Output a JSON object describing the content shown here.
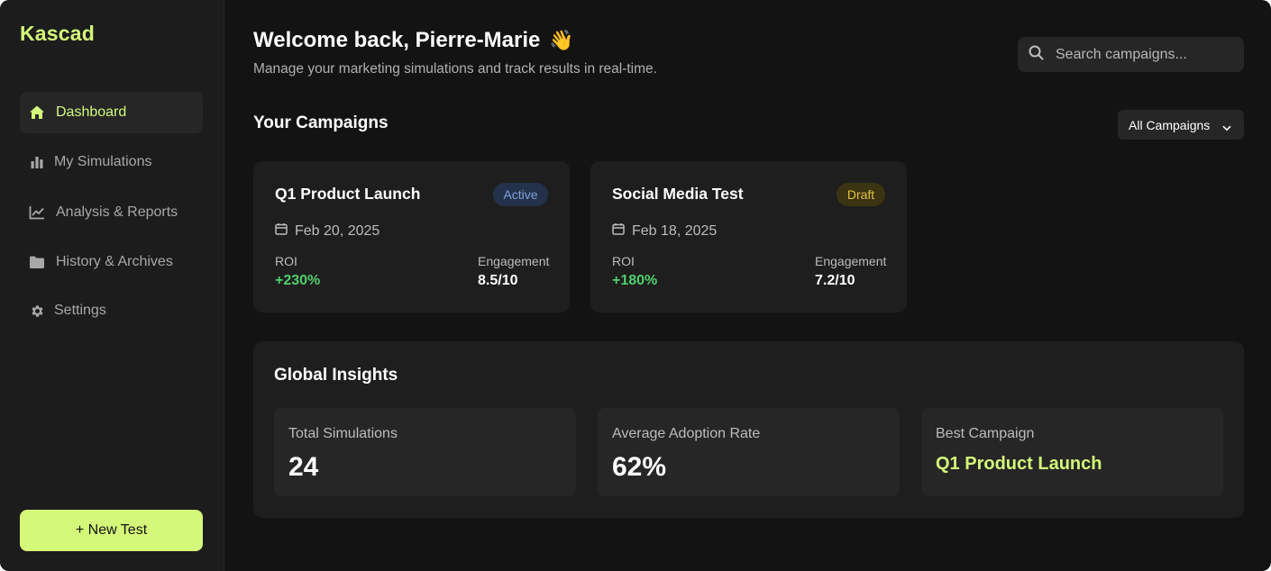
{
  "app": {
    "name": "Kascad",
    "accent_color": "#d4f87a"
  },
  "sidebar": {
    "items": [
      {
        "label": "Dashboard",
        "icon": "home-icon",
        "active": true
      },
      {
        "label": "My Simulations",
        "icon": "bar-chart-icon",
        "active": false
      },
      {
        "label": "Analysis & Reports",
        "icon": "line-chart-icon",
        "active": false
      },
      {
        "label": "History & Archives",
        "icon": "folder-icon",
        "active": false
      },
      {
        "label": "Settings",
        "icon": "gear-icon",
        "active": false
      }
    ],
    "new_test_label": "+ New Test"
  },
  "header": {
    "welcome": "Welcome back, Pierre-Marie",
    "wave_emoji": "👋",
    "subtitle": "Manage your marketing simulations and track results in real-time.",
    "search_placeholder": "Search campaigns..."
  },
  "campaigns": {
    "title": "Your Campaigns",
    "filter_selected": "All Campaigns",
    "items": [
      {
        "name": "Q1 Product Launch",
        "status": "Active",
        "status_color": "#7fa2dd",
        "date": "Feb 20, 2025",
        "roi_label": "ROI",
        "roi_value": "+230%",
        "engagement_label": "Engagement",
        "engagement_value": "8.5/10"
      },
      {
        "name": "Social Media Test",
        "status": "Draft",
        "status_color": "#e3c13e",
        "date": "Feb 18, 2025",
        "roi_label": "ROI",
        "roi_value": "+180%",
        "engagement_label": "Engagement",
        "engagement_value": "7.2/10"
      }
    ]
  },
  "insights": {
    "title": "Global Insights",
    "stats": [
      {
        "label": "Total Simulations",
        "value": "24"
      },
      {
        "label": "Average Adoption Rate",
        "value": "62%"
      },
      {
        "label": "Best Campaign",
        "value": "Q1 Product Launch"
      }
    ]
  }
}
